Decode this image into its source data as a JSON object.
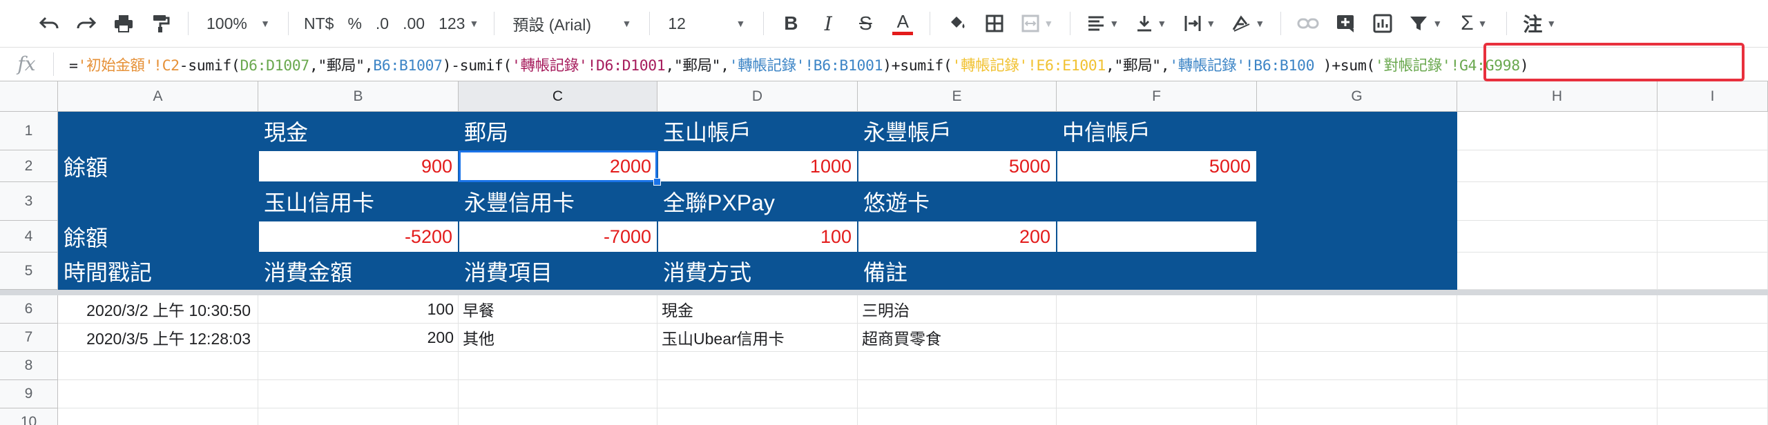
{
  "toolbar": {
    "zoom": "100%",
    "currency": "NT$",
    "percent": "%",
    "decrease_decimal": ".0",
    "increase_decimal": ".00",
    "more_formats": "123",
    "font": "預設 (Arial)",
    "font_size": "12",
    "bold": "B",
    "italic": "I",
    "strikethrough": "S",
    "text_color": "A",
    "function": "Σ",
    "comment": "注"
  },
  "formula_bar": {
    "fx": "fx",
    "formula": [
      {
        "text": "=",
        "color": "#202124"
      },
      {
        "text": "'初始金額'!C2",
        "color": "#e69138"
      },
      {
        "text": "-sumif(",
        "color": "#202124"
      },
      {
        "text": "D6:D1007",
        "color": "#6aa84f"
      },
      {
        "text": ",\"郵局\",",
        "color": "#202124"
      },
      {
        "text": "B6:B1007",
        "color": "#3d85c6"
      },
      {
        "text": ")-sumif(",
        "color": "#202124"
      },
      {
        "text": "'轉帳記錄'!D6:D1001",
        "color": "#a61c5c"
      },
      {
        "text": ",\"郵局\",",
        "color": "#202124"
      },
      {
        "text": "'轉帳記錄'!B6:B1001",
        "color": "#3d85c6"
      },
      {
        "text": ")+sumif(",
        "color": "#202124"
      },
      {
        "text": "'轉帳記錄'!E6:E1001",
        "color": "#f1c232"
      },
      {
        "text": ",\"郵局\",",
        "color": "#202124"
      },
      {
        "text": "'轉帳記錄'!B6:B100",
        "color": "#3d85c6"
      },
      {
        "text": " )+sum(",
        "color": "#202124"
      },
      {
        "text": "'對帳記錄'!G4:G998",
        "color": "#6aa84f"
      },
      {
        "text": ")",
        "color": "#202124"
      }
    ]
  },
  "columns": [
    "A",
    "B",
    "C",
    "D",
    "E",
    "F",
    "G",
    "H",
    "I"
  ],
  "rows": [
    "1",
    "2",
    "3",
    "4",
    "5",
    "6",
    "7",
    "8",
    "9",
    "10"
  ],
  "cells": {
    "a2": "餘額",
    "a4": "餘額",
    "a5": "時間戳記",
    "b1": "現金",
    "c1": "郵局",
    "d1": "玉山帳戶",
    "e1": "永豐帳戶",
    "f1": "中信帳戶",
    "b2": "900",
    "c2": "2000",
    "d2": "1000",
    "e2": "5000",
    "f2": "5000",
    "b3": "玉山信用卡",
    "c3": "永豐信用卡",
    "d3": "全聯PXPay",
    "e3": "悠遊卡",
    "b4": "-5200",
    "c4": "-7000",
    "d4": "100",
    "e4": "200",
    "b5": "消費金額",
    "c5": "消費項目",
    "d5": "消費方式",
    "e5": "備註",
    "a6": "2020/3/2 上午 10:30:50",
    "b6": "100",
    "c6": "早餐",
    "d6": "現金",
    "e6": "三明治",
    "a7": "2020/3/5 上午 12:28:03",
    "b7": "200",
    "c7": "其他",
    "d7": "玉山Ubear信用卡",
    "e7": "超商買零食"
  },
  "colors": {
    "header_blue": "#0b5394",
    "negative_red": "#e31b1b",
    "selection": "#1a73e8",
    "highlight_box": "#e8303d"
  }
}
